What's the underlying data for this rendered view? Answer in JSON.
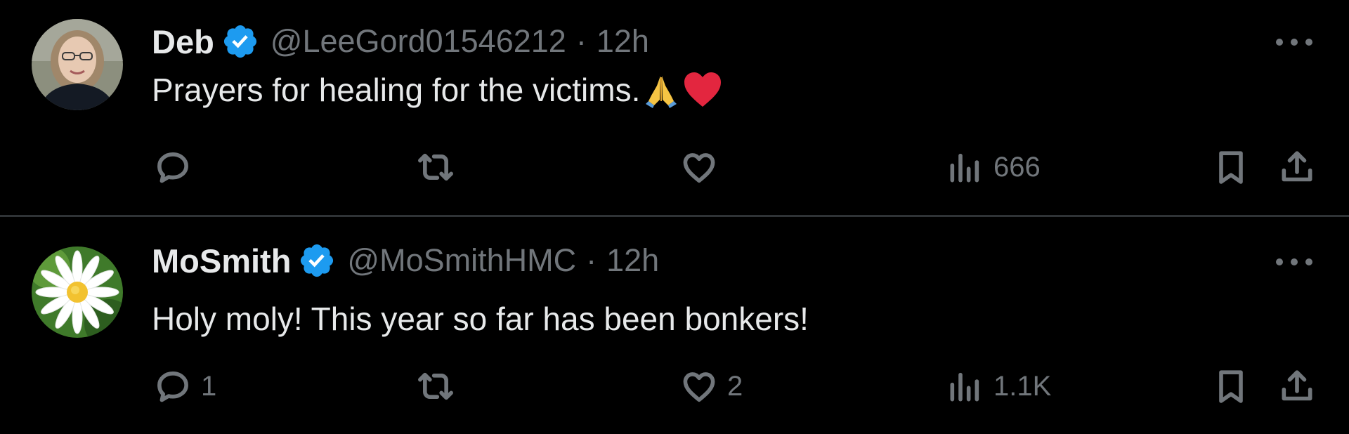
{
  "colors": {
    "background": "#000000",
    "text_primary": "#e7e9ea",
    "text_secondary": "#71767b",
    "verified_badge": "#1d9bf0",
    "divider": "#2f3336"
  },
  "posts": [
    {
      "author": {
        "name": "Deb",
        "handle": "@LeeGord01546212",
        "verified": true,
        "avatar_icon": "user-photo-avatar"
      },
      "separator": "·",
      "time": "12h",
      "text": "Prayers for healing for the victims.",
      "emojis": [
        "folded-hands-icon",
        "red-heart-icon"
      ],
      "metrics": {
        "replies": "",
        "reposts": "",
        "likes": "",
        "views": "666"
      }
    },
    {
      "author": {
        "name": "MoSmith",
        "handle": "@MoSmithHMC",
        "verified": true,
        "avatar_icon": "daisy-flower-avatar"
      },
      "separator": "·",
      "time": "12h",
      "text": "Holy moly! This year so far has been bonkers!",
      "emojis": [],
      "metrics": {
        "replies": "1",
        "reposts": "",
        "likes": "2",
        "views": "1.1K"
      }
    }
  ]
}
